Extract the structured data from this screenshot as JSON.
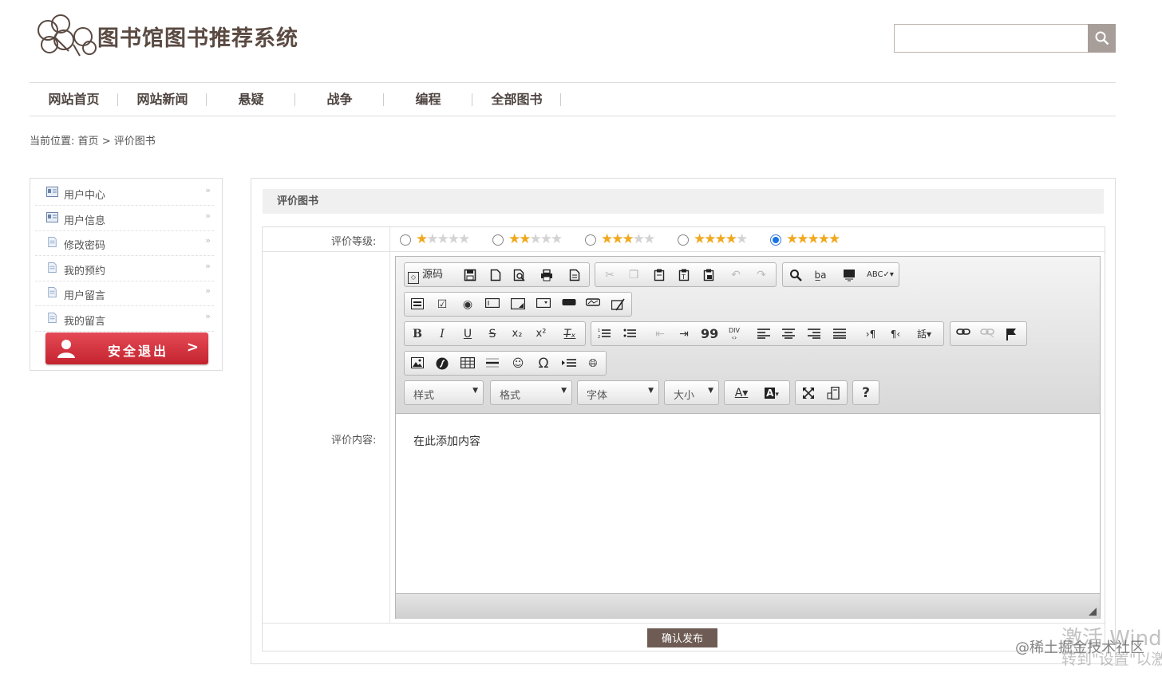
{
  "header": {
    "site_title": "图书馆图书推荐系统",
    "search": {
      "value": "",
      "placeholder": ""
    }
  },
  "nav": [
    "网站首页",
    "网站新闻",
    "悬疑",
    "战争",
    "编程",
    "全部图书"
  ],
  "breadcrumb": {
    "prefix": "当前位置:",
    "home": "首页",
    "sep": ">",
    "current": "评价图书"
  },
  "sidebar": {
    "items": [
      {
        "label": "用户中心",
        "icon": "id-card-icon"
      },
      {
        "label": "用户信息",
        "icon": "id-card-icon"
      },
      {
        "label": "修改密码",
        "icon": "document-icon"
      },
      {
        "label": "我的预约",
        "icon": "document-icon"
      },
      {
        "label": "用户留言",
        "icon": "document-icon"
      },
      {
        "label": "我的留言",
        "icon": "document-icon"
      }
    ],
    "logout_label": "安全退出"
  },
  "panel": {
    "title": "评价图书",
    "rating_label": "评价等级:",
    "rating_options": [
      1,
      2,
      3,
      4,
      5
    ],
    "rating_selected": 5,
    "content_label": "评价内容:",
    "source_label": "源码",
    "combos": {
      "style": "样式",
      "format": "格式",
      "font": "字体",
      "size": "大小"
    },
    "editor_content": "在此添加内容",
    "submit_label": "确认发布"
  },
  "watermarks": [
    "激活 Windo",
    "@稀土掘金技术社区",
    "转到\"设置\"以激"
  ],
  "colors": {
    "brand_brown": "#6e5c54",
    "logout_red": "#d3303b",
    "star": "#f0a81e"
  }
}
